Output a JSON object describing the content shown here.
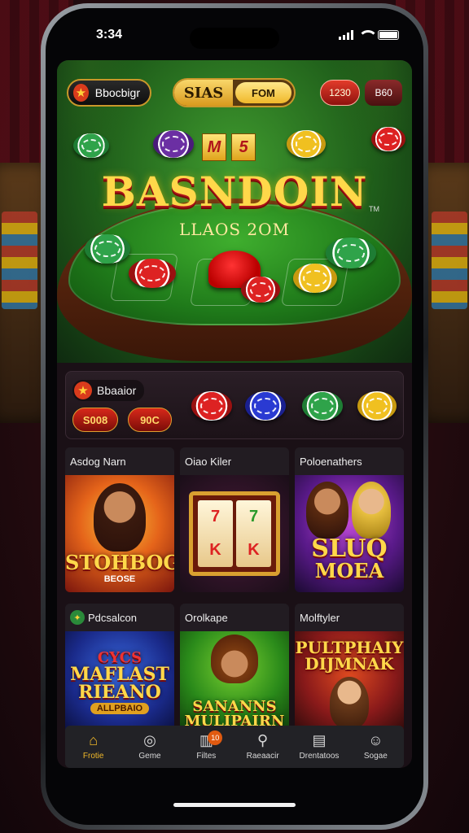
{
  "status_bar": {
    "time": "3:34"
  },
  "top_bar": {
    "logo_label": "Bbocbigr",
    "toggle_left": "SIAS",
    "toggle_right": "FOM",
    "balance": "1230",
    "coins": "B60"
  },
  "hero": {
    "badge": [
      "M",
      "5"
    ],
    "title": "BASNDOIN",
    "trademark": "TM",
    "subtitle": "LLAOS 2OM"
  },
  "bonus": {
    "title": "Bbaaior",
    "button_a": "S008",
    "button_b": "90C"
  },
  "games": [
    {
      "label": "Asdog Narn",
      "art_title": "STOHBOG",
      "art_sub": "BEOSE"
    },
    {
      "label": "Oiao Kiler",
      "art_title": "",
      "art_sub": ""
    },
    {
      "label": "Poloenathers",
      "art_title": "SLUQ",
      "art_sub": "MOEA"
    },
    {
      "label": "Pdcsalcon",
      "art_title": "MAFLAST RIEANO",
      "art_sub": "ALLPBAIO",
      "art_top": "CYCS"
    },
    {
      "label": "Orolkape",
      "art_title": "SANANNS MULIPAIRN",
      "art_sub": ""
    },
    {
      "label": "Molftyler",
      "art_title": "PULTPHAIY DIJMNAK",
      "art_sub": ""
    }
  ],
  "bottom_nav": [
    {
      "label": "Frotie",
      "icon": "home-icon"
    },
    {
      "label": "Geme",
      "icon": "gem-icon"
    },
    {
      "label": "Filtes",
      "icon": "slot-icon",
      "badge": "10"
    },
    {
      "label": "Raeaacir",
      "icon": "search-icon"
    },
    {
      "label": "Drentatoos",
      "icon": "list-icon"
    },
    {
      "label": "Sogae",
      "icon": "user-icon"
    }
  ],
  "colors": {
    "accent_gold": "#f0b82a",
    "felt_green": "#1f7a1a",
    "chip_red": "#dd2222"
  }
}
